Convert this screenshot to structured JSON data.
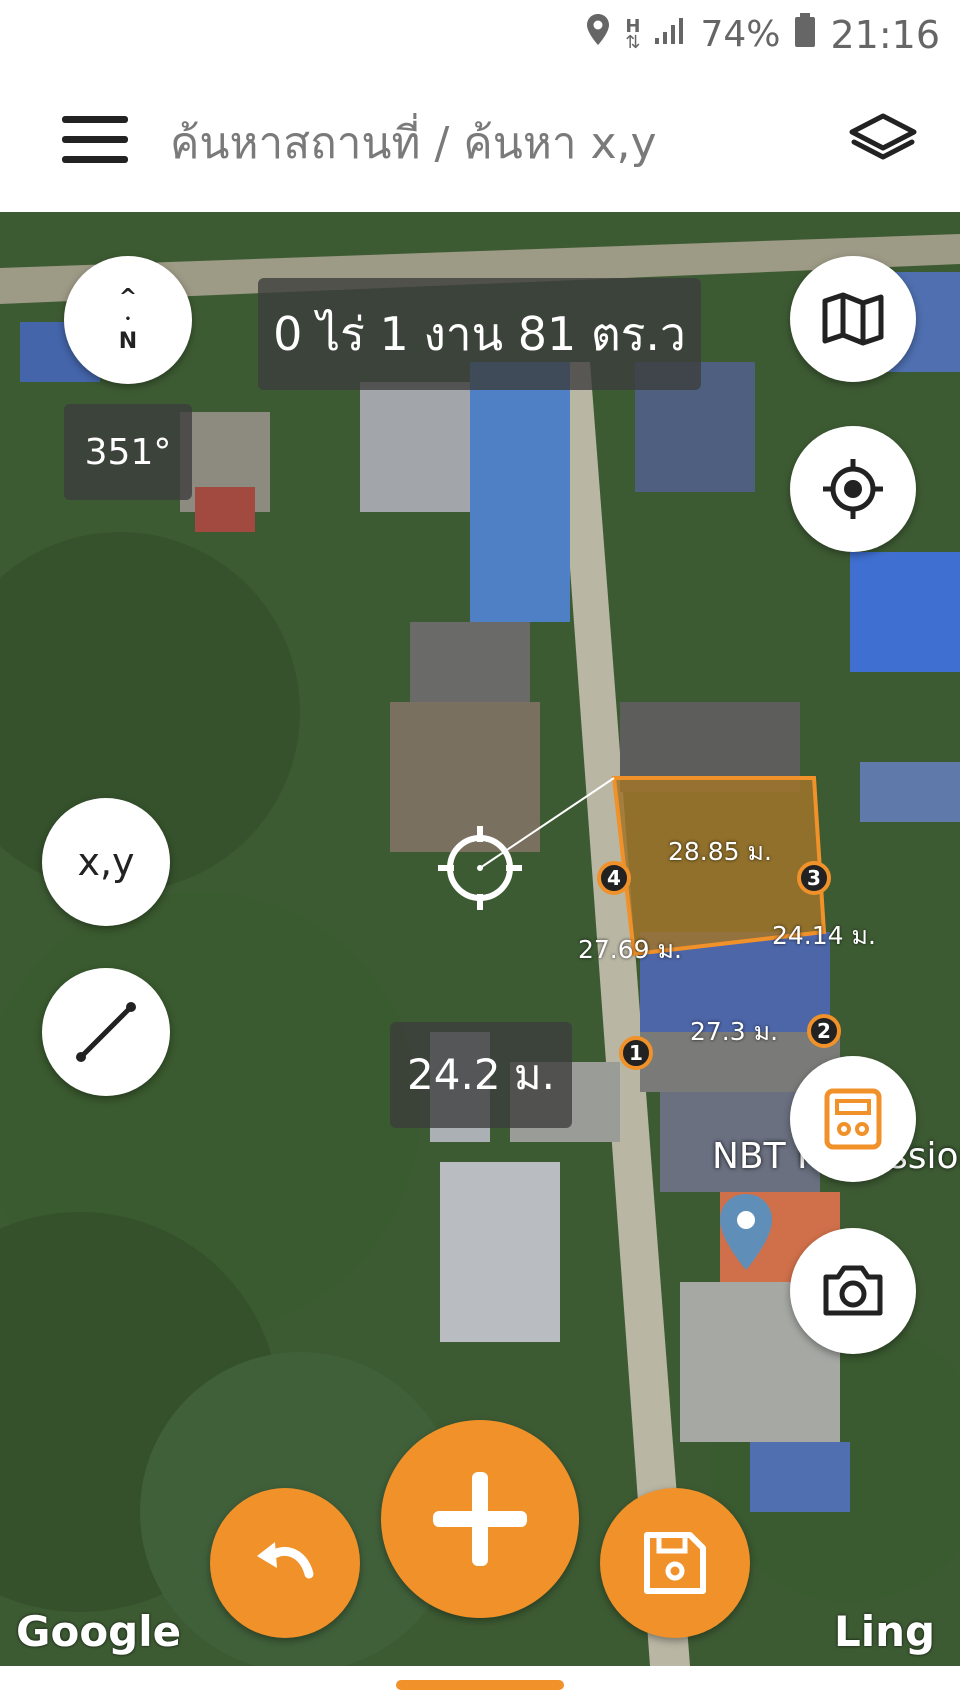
{
  "status_bar": {
    "signal_type": "H",
    "battery": "74%",
    "time": "21:16",
    "icons": [
      "location-icon",
      "data-arrows-icon",
      "signal-icon",
      "battery-icon"
    ]
  },
  "app_bar": {
    "search_placeholder": "ค้นหาสถานที่ / ค้นหา x,y",
    "menu_icon": "hamburger-menu-icon",
    "layers_icon": "layers-icon"
  },
  "map": {
    "area_display": "0 ไร่ 1 งาน 81 ตร.ว",
    "compass": {
      "arrow": "^",
      "label": "N"
    },
    "bearing": "351°",
    "distance_to_point": "24.2 ม.",
    "xy_button_label": "x,y",
    "poi_label": "NBT Profession",
    "google_logo": "Google",
    "watermark": "Ling",
    "plot": {
      "fill_color": "#a0742a",
      "outline_color": "#f0912a",
      "vertices": [
        {
          "label": "1"
        },
        {
          "label": "2"
        },
        {
          "label": "3"
        },
        {
          "label": "4"
        }
      ],
      "edges": [
        {
          "from": "4",
          "to": "3",
          "length": "28.85 ม."
        },
        {
          "from": "3",
          "to": "2",
          "length": "24.14 ม."
        },
        {
          "from": "1",
          "to": "2",
          "length": "27.3 ม."
        },
        {
          "from": "1",
          "to": "4",
          "length": "27.69 ม."
        }
      ]
    }
  },
  "buttons": {
    "map_type": "map-icon",
    "my_location": "crosshair-location-icon",
    "calculator": "calculator-icon",
    "camera": "camera-icon",
    "undo": "undo-icon",
    "add_point": "plus-icon",
    "save": "save-disk-icon",
    "ruler": "line-measure-icon"
  },
  "colors": {
    "accent": "#f0912a",
    "pill_bg": "#3c3c3c",
    "app_bar_bg": "#ffffff"
  }
}
